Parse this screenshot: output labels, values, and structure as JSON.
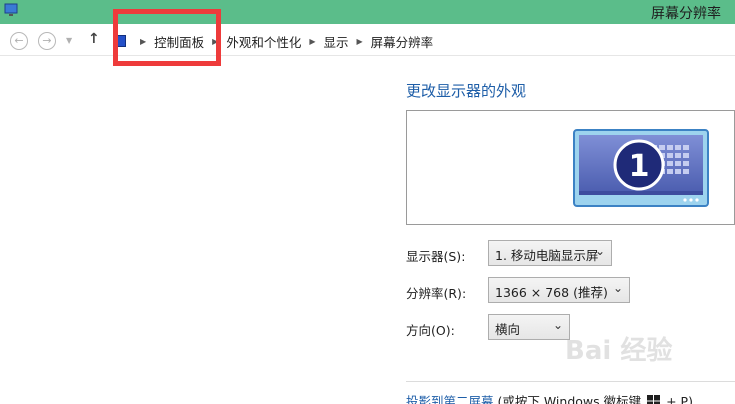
{
  "window": {
    "title": "屏幕分辨率"
  },
  "breadcrumb": [
    "控制面板",
    "外观和个性化",
    "显示",
    "屏幕分辨率"
  ],
  "main": {
    "heading": "更改显示器的外观",
    "monitor_number": "1",
    "display": {
      "label": "显示器(S):",
      "value": "1. 移动电脑显示屏"
    },
    "resolution": {
      "label": "分辨率(R):",
      "value": "1366 × 768 (推荐)"
    },
    "orientation": {
      "label": "方向(O):",
      "value": "横向"
    },
    "footer": {
      "link": "投影到第二屏幕",
      "rest_a": "(或按下 Windows 徽标键",
      "rest_b": "+ P)"
    }
  },
  "watermark": "Bai 经验",
  "colors": {
    "titlebar": "#5bbd8a",
    "link": "#1e5ea8",
    "highlight": "#ee3b3b"
  }
}
